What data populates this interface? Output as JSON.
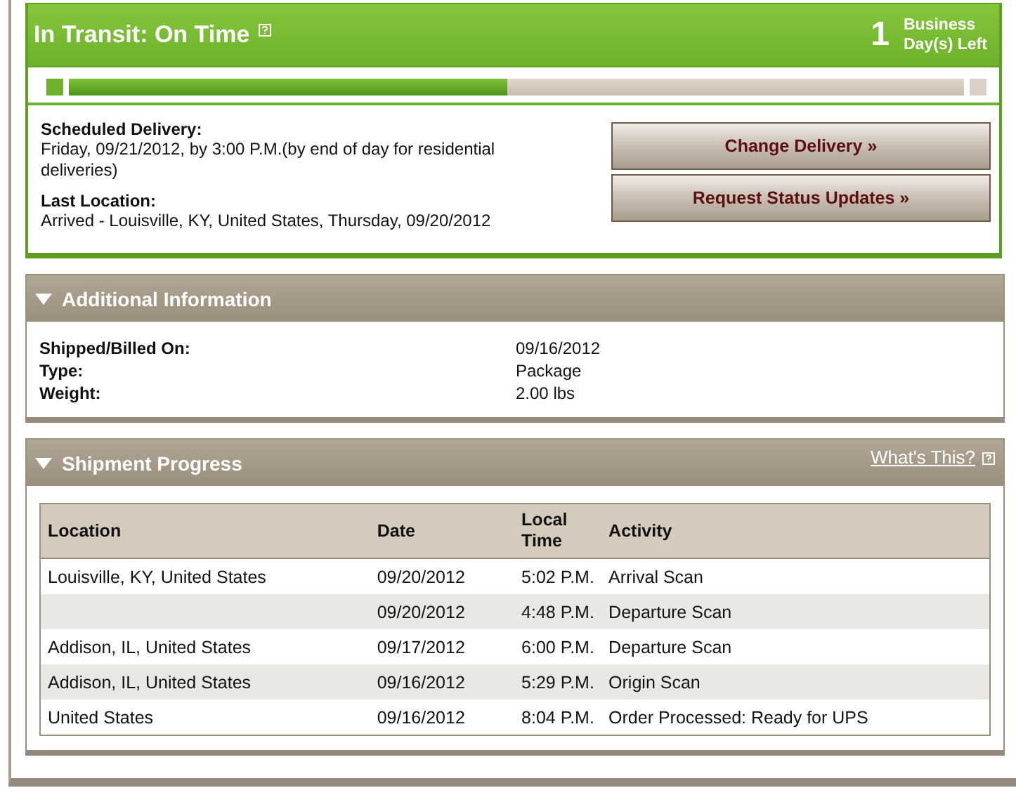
{
  "status": {
    "title": "In Transit: On Time",
    "days": "1",
    "days_label": "Business Day(s) Left",
    "level": 0.49
  },
  "delivery": [
    {
      "label": "Scheduled Delivery:",
      "value": "Friday, 09/21/2012, by 3:00 P.M.(by end of day for residential deliveries)"
    },
    {
      "label": "Last Location:",
      "value": "Arrived - Louisville, KY, United States, Thursday, 09/20/2012"
    }
  ],
  "buttons": [
    "Change Delivery »",
    "Request Status Updates »"
  ],
  "additional": {
    "title": "Additional Information",
    "expanded": true,
    "rows": [
      {
        "label": "Shipped/Billed On:",
        "value": "09/16/2012"
      },
      {
        "label": "Type:",
        "value": "Package"
      },
      {
        "label": "Weight:",
        "value": "2.00 lbs"
      }
    ]
  },
  "progress": {
    "title": "Shipment Progress",
    "expanded": true,
    "help_link": "What's This?",
    "columns": [
      "Location",
      "Date",
      "Local Time",
      "Activity"
    ],
    "rows": [
      [
        "Louisville, KY, United States",
        "09/20/2012",
        "5:02 P.M.",
        "Arrival Scan"
      ],
      [
        "",
        "09/20/2012",
        "4:48 P.M.",
        "Departure Scan"
      ],
      [
        "Addison, IL, United States",
        "09/17/2012",
        "6:00 P.M.",
        "Departure Scan"
      ],
      [
        "Addison, IL, United States",
        "09/16/2012",
        "5:29 P.M.",
        "Origin Scan"
      ],
      [
        "United States",
        "09/16/2012",
        "8:04 P.M.",
        "Order Processed: Ready for UPS"
      ]
    ]
  }
}
